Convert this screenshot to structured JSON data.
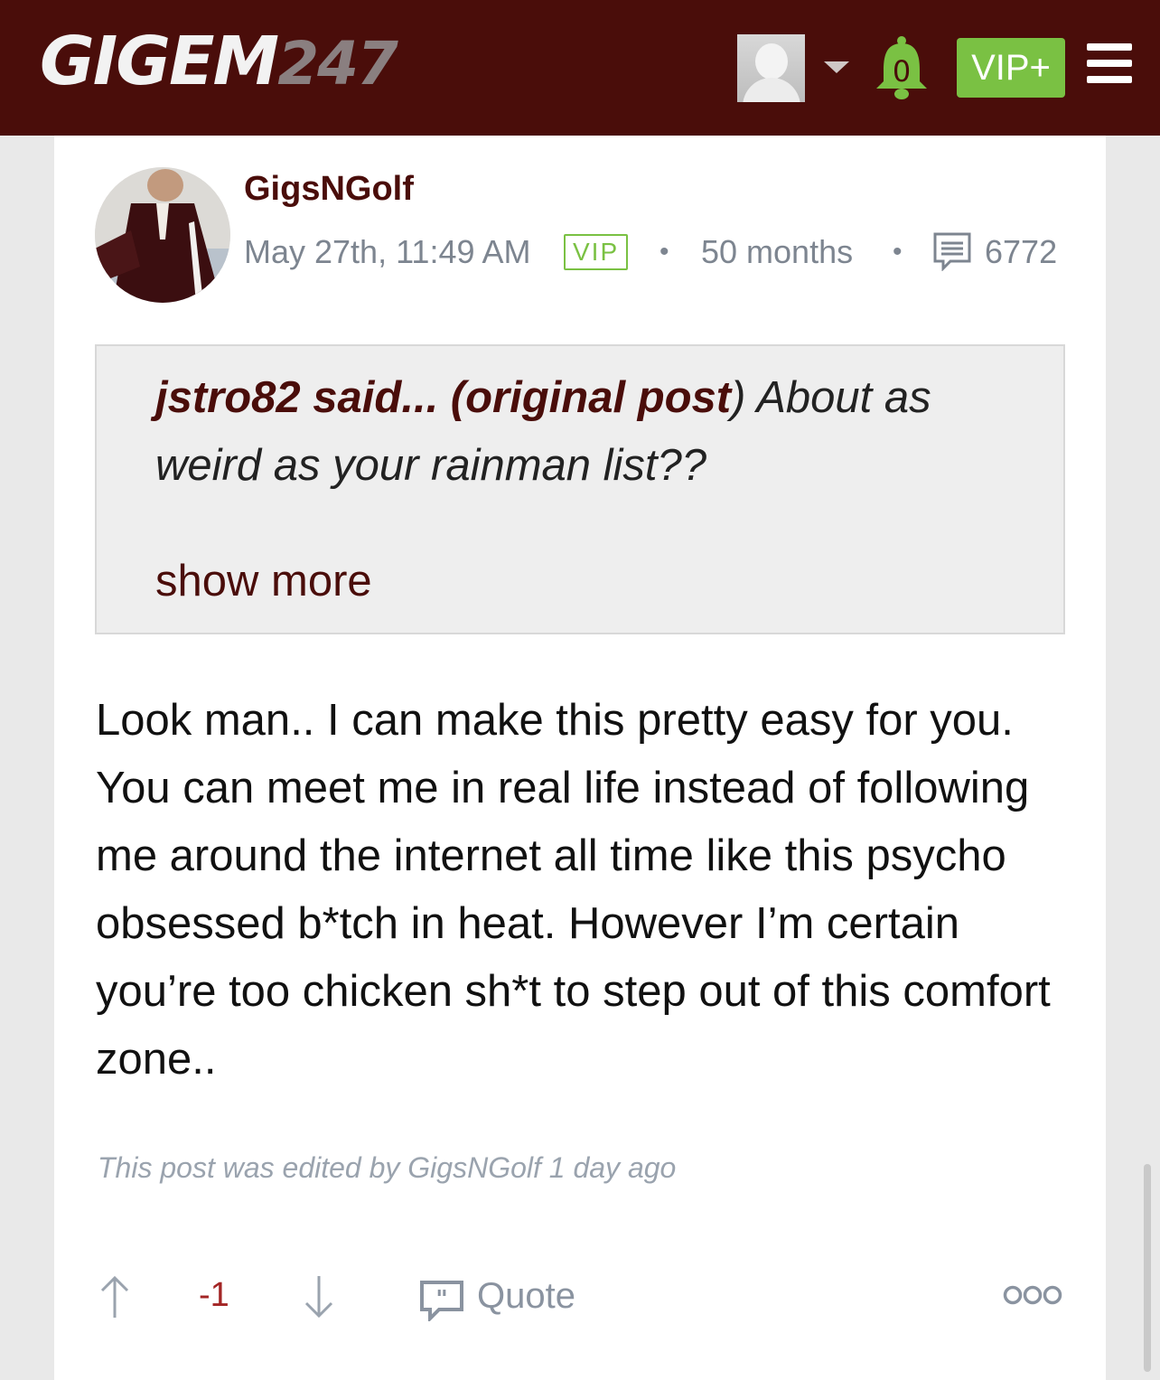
{
  "header": {
    "logo_text": "GIGEM",
    "logo_number": "247",
    "notification_count": "0",
    "vip_button_label": "VIP+",
    "colors": {
      "bar": "#4a0d0a",
      "accent_green": "#7ac143"
    }
  },
  "post": {
    "author": "GigsNGolf",
    "timestamp": "May 27th, 11:49 AM",
    "badge": "VIP",
    "separator": "•",
    "tenure": "50 months",
    "post_count": "6772",
    "quote": {
      "user_text": "jstro82 said... (original post",
      "close_paren": ")",
      "text": " About as weird as your rainman list??",
      "show_more_label": "show more"
    },
    "body": "Look man.. I can make this pretty easy for you. You can meet me in real life instead of following me around the internet all time like this psycho obsessed b*tch in heat. However I’m certain you’re too chicken sh*t to step out of this comfort zone..",
    "edited_note": "This post was edited by GigsNGolf 1 day ago",
    "actions": {
      "score": "-1",
      "quote_label": "Quote"
    }
  }
}
